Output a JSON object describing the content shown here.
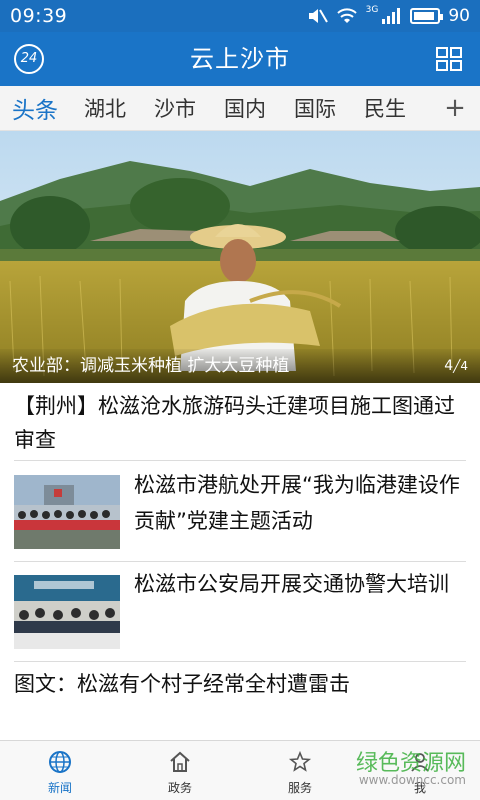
{
  "status": {
    "time": "09:39",
    "network": "3G",
    "battery": "90",
    "battery_level": 0.9
  },
  "appbar": {
    "title": "云上沙市",
    "badge": "24"
  },
  "tabs": [
    {
      "label": "头条"
    },
    {
      "label": "湖北"
    },
    {
      "label": "沙市"
    },
    {
      "label": "国内"
    },
    {
      "label": "国际"
    },
    {
      "label": "民生"
    }
  ],
  "tabs_add": "+",
  "hero": {
    "caption": "农业部：调减玉米种植 扩大大豆种植",
    "page_current": "4",
    "page_total": "4"
  },
  "news": {
    "item1": "【荆州】松滋沧水旅游码头迁建项目施工图通过审查",
    "item2": "松滋市港航处开展“我为临港建设作贡献”党建主题活动",
    "item3": "松滋市公安局开展交通协警大培训",
    "item4": "图文：松滋有个村子经常全村遭雷击"
  },
  "bottom_nav": [
    {
      "label": "新闻",
      "icon": "globe-icon"
    },
    {
      "label": "政务",
      "icon": "home-icon"
    },
    {
      "label": "服务",
      "icon": "star-icon"
    },
    {
      "label": "我",
      "icon": "person-icon"
    }
  ],
  "watermark": {
    "text": "绿色资源网",
    "url": "www.downcc.com"
  },
  "colors": {
    "primary": "#1a74c7",
    "statusbar": "#1b6fbe",
    "watermark": "#3db03f"
  }
}
